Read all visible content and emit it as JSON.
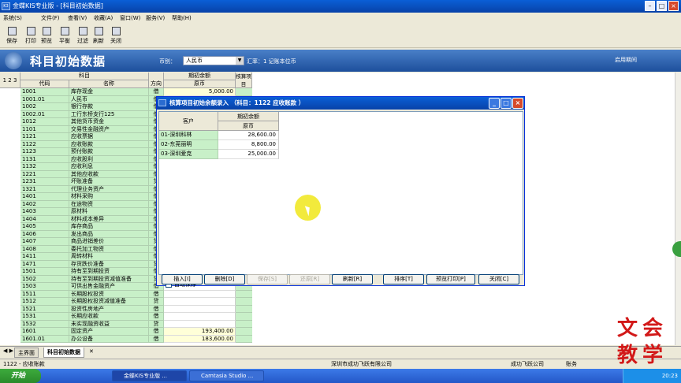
{
  "window": {
    "title": "金蝶KIS专业版 - [科目初始数据]",
    "app_icon": "K3"
  },
  "menubar": [
    "系统(S)",
    "文件(F)",
    "查看(V)",
    "收藏(A)",
    "窗口(W)",
    "服务(V)",
    "帮助(H)"
  ],
  "toolbar": [
    {
      "icon": "save-icon",
      "label": "保存"
    },
    {
      "icon": "print-icon",
      "label": "打印"
    },
    {
      "icon": "preview-icon",
      "label": "预览"
    },
    {
      "icon": "balance-icon",
      "label": "平衡"
    },
    {
      "icon": "filter-icon",
      "label": "过滤"
    },
    {
      "icon": "refresh-icon",
      "label": "刷新"
    },
    {
      "icon": "close-icon",
      "label": "关闭"
    }
  ],
  "header": {
    "title": "科目初始数据",
    "currency_label": "币别：",
    "currency_value": "人民币",
    "rate_text": "汇率：1  记账本位币",
    "enable_text": "启用期间"
  },
  "grid": {
    "col_headers": {
      "levels": "1 2 3",
      "subject": "科目",
      "code": "代码",
      "name": "名称",
      "direction": "方向",
      "opening": "期初余额",
      "original": "原币",
      "check": "核算项目"
    },
    "rows": [
      {
        "code": "1001",
        "name": "库存现金",
        "dir": "借",
        "amt": "5,000.00"
      },
      {
        "code": "1001.01",
        "name": "人民币",
        "dir": "借",
        "amt": "5,000.00"
      },
      {
        "code": "1002",
        "name": "银行存款",
        "dir": "借",
        "amt": ""
      },
      {
        "code": "1002.01",
        "name": "工行东桥支行125",
        "dir": "借",
        "amt": ""
      },
      {
        "code": "1012",
        "name": "其他货币资金",
        "dir": "借",
        "amt": ""
      },
      {
        "code": "1101",
        "name": "交易性金融资产",
        "dir": "借",
        "amt": ""
      },
      {
        "code": "1121",
        "name": "应收票据",
        "dir": "借",
        "amt": ""
      },
      {
        "code": "1122",
        "name": "应收账款",
        "dir": "借",
        "amt": ""
      },
      {
        "code": "1123",
        "name": "预付账款",
        "dir": "借",
        "amt": ""
      },
      {
        "code": "1131",
        "name": "应收股利",
        "dir": "借",
        "amt": ""
      },
      {
        "code": "1132",
        "name": "应收利息",
        "dir": "借",
        "amt": ""
      },
      {
        "code": "1221",
        "name": "其他应收款",
        "dir": "借",
        "amt": ""
      },
      {
        "code": "1231",
        "name": "坏账准备",
        "dir": "贷",
        "amt": ""
      },
      {
        "code": "1321",
        "name": "代理业务资产",
        "dir": "借",
        "amt": ""
      },
      {
        "code": "1401",
        "name": "材料采购",
        "dir": "借",
        "amt": ""
      },
      {
        "code": "1402",
        "name": "在途物资",
        "dir": "借",
        "amt": ""
      },
      {
        "code": "1403",
        "name": "原材料",
        "dir": "借",
        "amt": ""
      },
      {
        "code": "1404",
        "name": "材料成本差异",
        "dir": "借",
        "amt": ""
      },
      {
        "code": "1405",
        "name": "库存商品",
        "dir": "借",
        "amt": ""
      },
      {
        "code": "1406",
        "name": "发出商品",
        "dir": "借",
        "amt": ""
      },
      {
        "code": "1407",
        "name": "商品进销差价",
        "dir": "贷",
        "amt": ""
      },
      {
        "code": "1408",
        "name": "委托加工物资",
        "dir": "借",
        "amt": ""
      },
      {
        "code": "1411",
        "name": "周转材料",
        "dir": "借",
        "amt": ""
      },
      {
        "code": "1471",
        "name": "存货跌价准备",
        "dir": "贷",
        "amt": ""
      },
      {
        "code": "1501",
        "name": "持有至到期投资",
        "dir": "借",
        "amt": ""
      },
      {
        "code": "1502",
        "name": "持有至到期投资减值准备",
        "dir": "贷",
        "amt": ""
      },
      {
        "code": "1503",
        "name": "可供出售金融资产",
        "dir": "借",
        "amt": ""
      },
      {
        "code": "1511",
        "name": "长期股权投资",
        "dir": "借",
        "amt": ""
      },
      {
        "code": "1512",
        "name": "长期股权投资减值准备",
        "dir": "贷",
        "amt": ""
      },
      {
        "code": "1521",
        "name": "投资性房地产",
        "dir": "借",
        "amt": ""
      },
      {
        "code": "1531",
        "name": "长期应收款",
        "dir": "借",
        "amt": ""
      },
      {
        "code": "1532",
        "name": "未实现融资收益",
        "dir": "贷",
        "amt": ""
      },
      {
        "code": "1601",
        "name": "固定资产",
        "dir": "借",
        "amt": "193,400.00"
      },
      {
        "code": "1601.01",
        "name": "办公设备",
        "dir": "借",
        "amt": "183,600.00"
      }
    ]
  },
  "dialog": {
    "title": "核算项目初始余额录入 （科目：1122 应收账款 ）",
    "col_customer": "客户",
    "col_opening": "期初余额",
    "col_original": "原币",
    "rows": [
      {
        "customer": "01-深圳科林",
        "value": "28,600.00"
      },
      {
        "customer": "02-东莞丽明",
        "value": "8,800.00"
      },
      {
        "customer": "03-深圳爱克",
        "value": "25,000.00"
      }
    ],
    "autosave_label": "自动保存",
    "buttons": [
      {
        "label": "插入[I]",
        "enabled": true
      },
      {
        "label": "删除[D]",
        "enabled": true
      },
      {
        "label": "保存[S]",
        "enabled": false
      },
      {
        "label": "还原[R]",
        "enabled": false
      },
      {
        "label": "刷新[R]",
        "enabled": true
      },
      {
        "label": "排序[T]",
        "enabled": true
      },
      {
        "label": "预览打印[P]",
        "enabled": true
      },
      {
        "label": "关闭[C]",
        "enabled": true
      }
    ]
  },
  "sheet_tabs": [
    "主界面",
    "科目初始数据"
  ],
  "status": {
    "left": "1122 - 应收账款",
    "company": "深圳市成功飞跃有限公司",
    "account": "成功飞跃公司",
    "user": "账务"
  },
  "taskbar": {
    "start": "开始",
    "items": [
      "金蝶KIS专业版 ...",
      "Camtasia Studio ..."
    ],
    "clock": "20:23"
  },
  "watermark": {
    "chars": [
      "文",
      "会",
      "教",
      "学"
    ]
  },
  "colors": {
    "accent": "#0a5fd6",
    "green_cell": "#c8f0c8",
    "cursor_highlight": "#f2ea3c",
    "watermark": "#d21818"
  }
}
